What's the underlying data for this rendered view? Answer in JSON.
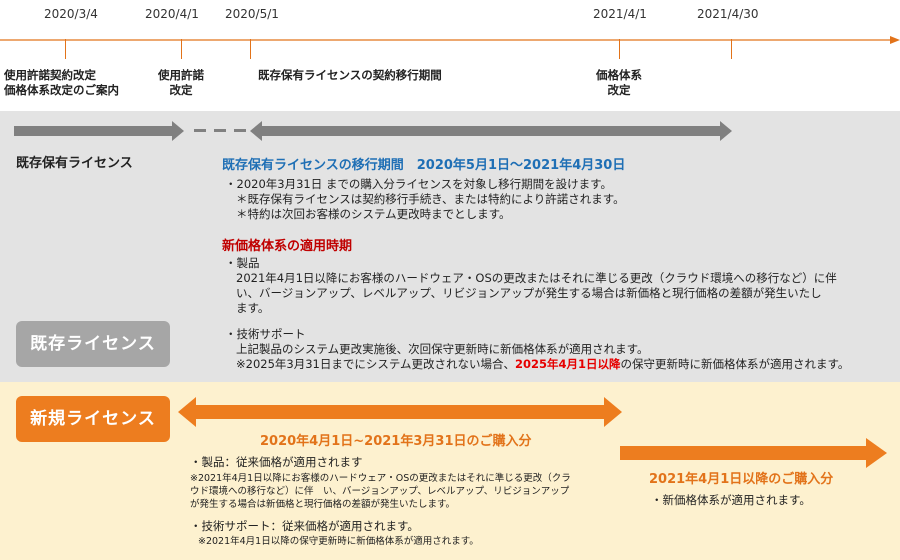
{
  "timeline": {
    "dates": [
      "2020/3/4",
      "2020/4/1",
      "2020/5/1",
      "2021/4/1",
      "2021/4/30"
    ],
    "milestones": [
      {
        "lines": [
          "使用許諾契約改定",
          "価格体系改定のご案内"
        ]
      },
      {
        "lines": [
          "使用許諾",
          "改定"
        ]
      },
      {
        "lines": [
          "既存保有ライセンスの契約移行期間"
        ]
      },
      {
        "lines": [
          "価格体系",
          "改定"
        ]
      }
    ]
  },
  "existing": {
    "row_label": "既存保有ライセンス",
    "badge": "既存ライセンス",
    "migration_heading": "既存保有ライセンスの移行期間　2020年5月1日～2021年4月30日",
    "migration_lines": [
      "・2020年3月31日 までの購入分ライセンスを対象し移行期間を設けます。",
      "＊既存保有ライセンスは契約移行手続き、または特約により許諾されます。",
      "＊特約は次回お客様のシステム更改時までとします。"
    ],
    "pricing_heading": "新価格体系の適用時期",
    "product_title": "・製品",
    "product_lines": [
      "2021年4月1日以降にお客様のハードウェア・OSの更改またはそれに準じる更改（クラウド環境への移行など）に伴",
      "い、バージョンアップ、レベルアップ、リビジョンアップが発生する場合は新価格と現行価格の差額が発生いたし",
      "ます。"
    ],
    "support_title": "・技術サポート",
    "support_line1": "上記製品のシステム更改実施後、次回保守更新時に新価格体系が適用されます。",
    "support_line2_pre": "※2025年3月31日までにシステム更改されない場合、",
    "support_line2_highlight": "2025年4月1日以降",
    "support_line2_post": "の保守更新時に新価格体系が適用されます。"
  },
  "new": {
    "badge": "新規ライセンス",
    "period1_heading": "2020年4月1日~2021年3月31日のご購入分",
    "product_title": "・製品：従来価格が適用されます",
    "product_notes": [
      "※2021年4月1日以降にお客様のハードウェア・OSの更改またはそれに準じる更改（クラ",
      "ウド環境への移行など）に伴　い、バージョンアップ、レベルアップ、リビジョンアップ",
      "が発生する場合は新価格と現行価格の差額が発生いたします。"
    ],
    "support_title": "・技術サポート：従来価格が適用されます。",
    "support_note": "※2021年4月1日以降の保守更新時に新価格体系が適用されます。",
    "period2_heading": "2021年4月1日以降のご購入分",
    "period2_line": "・新価格体系が適用されます。"
  },
  "colors": {
    "accent_orange": "#e2731a",
    "arrow_gray": "#808080",
    "badge_gray": "#a6a6a6",
    "heading_blue": "#1f6fb5",
    "heading_red": "#c00000",
    "highlight_red": "#e60000",
    "band_gray": "#e3e3e3",
    "band_yellow": "#fdf1cf"
  }
}
